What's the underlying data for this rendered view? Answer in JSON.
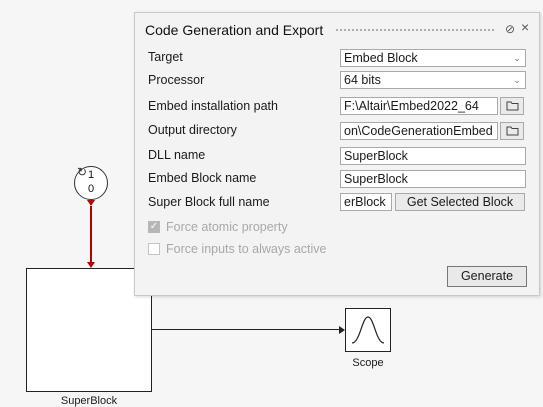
{
  "dialog": {
    "title": "Code Generation and Export",
    "help_icon": "help-icon",
    "close_icon": "close-icon",
    "fields": {
      "target": {
        "label": "Target",
        "value": "Embed Block"
      },
      "processor": {
        "label": "Processor",
        "value": "64 bits"
      },
      "embed_path": {
        "label": "Embed installation path",
        "value": "F:\\Altair\\Embed2022_64"
      },
      "output_dir": {
        "label": "Output directory",
        "value": "on\\CodeGenerationEmbed"
      },
      "dll_name": {
        "label": "DLL name",
        "value": "SuperBlock"
      },
      "embed_block_name": {
        "label": "Embed Block name",
        "value": "SuperBlock"
      },
      "superblock_full_name": {
        "label": "Super Block full name",
        "value": "erBlock",
        "button": "Get Selected Block"
      }
    },
    "checkboxes": {
      "force_atomic": {
        "label": "Force atomic property",
        "checked": true
      },
      "force_inputs": {
        "label": "Force inputs to always active",
        "checked": false
      }
    },
    "generate_label": "Generate"
  },
  "diagram": {
    "clock": {
      "top": "1",
      "bottom": "0"
    },
    "superblock_label": "SuperBlock",
    "scope_label": "Scope",
    "colors": {
      "event_link": "#b80000",
      "data_link": "#222222"
    }
  }
}
